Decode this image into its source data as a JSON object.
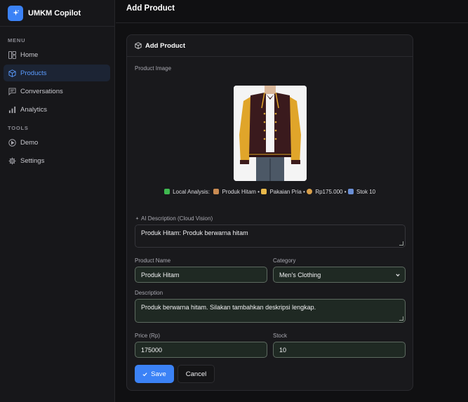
{
  "app": {
    "title": "UMKM Copilot"
  },
  "sidebar": {
    "menu_label": "MENU",
    "tools_label": "TOOLS",
    "menu_items": [
      {
        "label": "Home",
        "icon": "layout-icon"
      },
      {
        "label": "Products",
        "icon": "box-icon",
        "active": true
      },
      {
        "label": "Conversations",
        "icon": "chat-icon"
      },
      {
        "label": "Analytics",
        "icon": "bar-chart-icon"
      }
    ],
    "tool_items": [
      {
        "label": "Demo",
        "icon": "play-circle-icon"
      },
      {
        "label": "Settings",
        "icon": "gear-icon"
      }
    ]
  },
  "header": {
    "title": "Add Product"
  },
  "form": {
    "card_title": "Add Product",
    "image_label": "Product Image",
    "analysis": {
      "prefix": "Local Analysis:",
      "product": "Produk Hitam",
      "category": "Pakaian Pria",
      "price": "Rp175.000",
      "stock": "Stok 10"
    },
    "ai_description_label": "AI Description (Cloud Vision)",
    "ai_description_value": "Produk Hitam: Produk berwarna hitam",
    "name_label": "Product Name",
    "name_value": "Produk Hitam",
    "category_label": "Category",
    "category_value": "Men's Clothing",
    "description_label": "Description",
    "description_value": "Produk berwarna hitam. Silakan tambahkan deskripsi lengkap.",
    "price_label": "Price (Rp)",
    "price_value": "175000",
    "stock_label": "Stock",
    "stock_value": "10",
    "save_label": "Save",
    "cancel_label": "Cancel"
  },
  "colors": {
    "accent": "#3b82f6",
    "input_bg": "#1f2923",
    "input_border": "#5d6a60",
    "sidebar_bg": "#17171a"
  }
}
